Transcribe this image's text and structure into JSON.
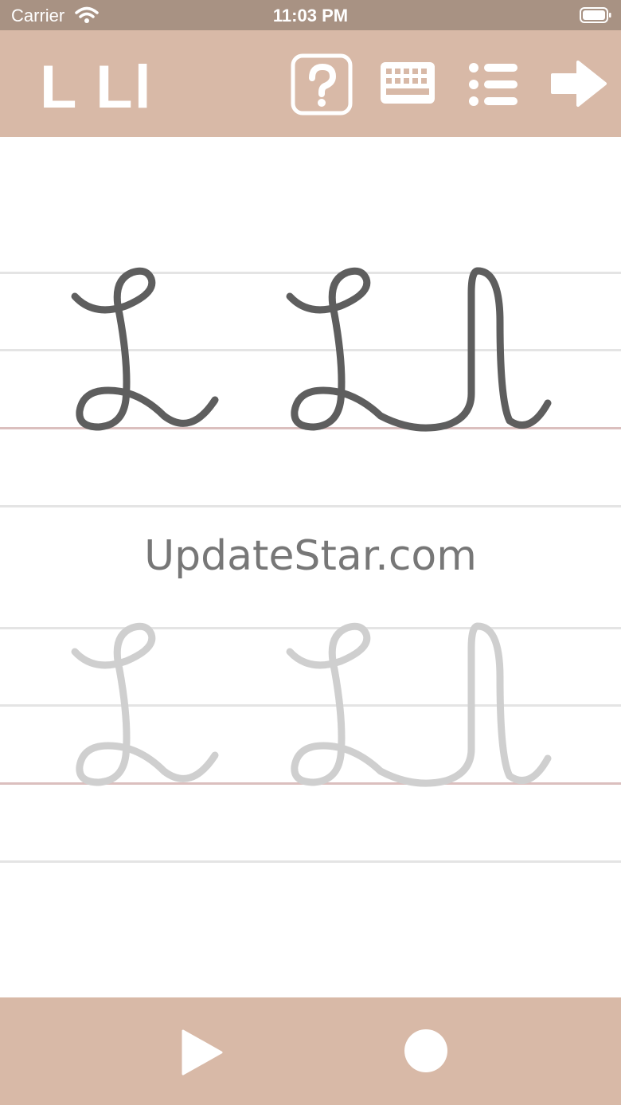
{
  "status": {
    "carrier": "Carrier",
    "time": "11:03 PM"
  },
  "toolbar": {
    "title": "L Ll",
    "buttons": [
      "help-icon",
      "keyboard-icon",
      "list-icon",
      "arrow-right-icon"
    ]
  },
  "watermark": "UpdateStar.com",
  "colors": {
    "bar": "#d8b9a7",
    "status": "#a89283",
    "ink": "#5e5e5e",
    "guide": "#cfcfcf"
  },
  "bottom": {
    "buttons": [
      "play-icon",
      "record-icon"
    ]
  }
}
